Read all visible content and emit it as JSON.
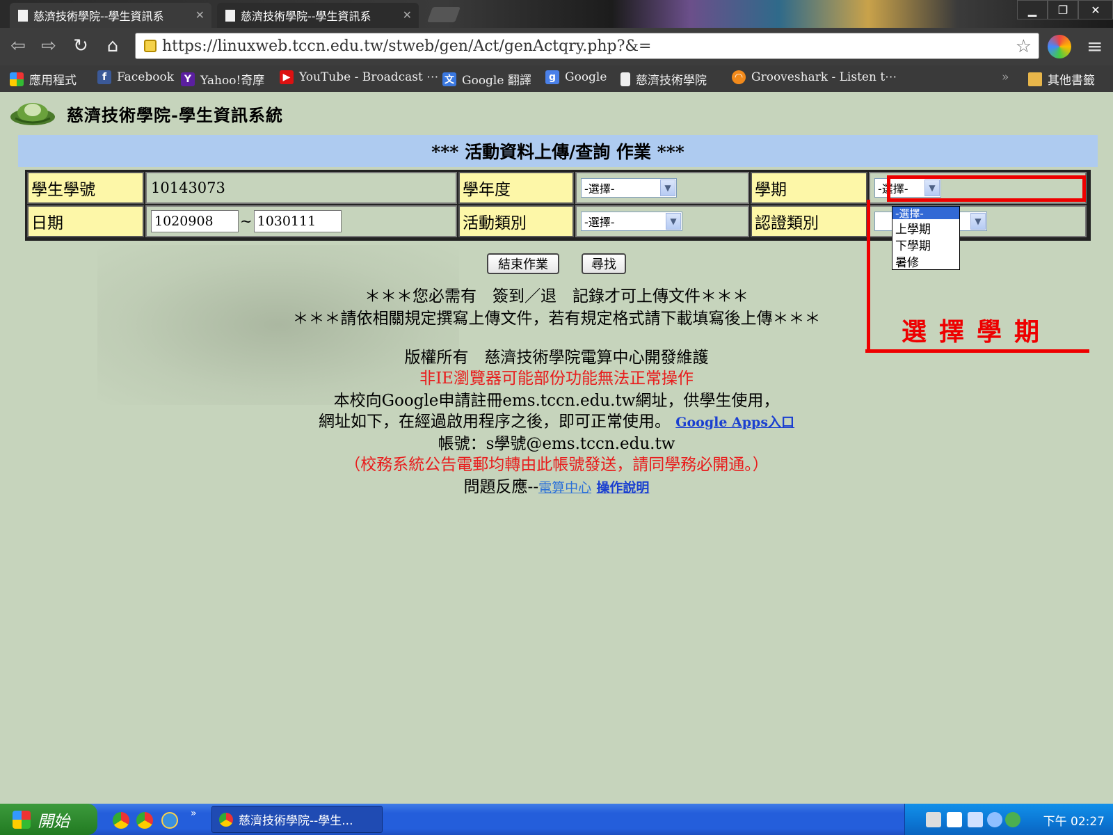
{
  "browser": {
    "tabs": [
      {
        "title": "慈濟技術學院--學生資訊系"
      },
      {
        "title": "慈濟技術學院--學生資訊系"
      }
    ],
    "url": "https://linuxweb.tccn.edu.tw/stweb/gen/Act/genActqry.php?&=",
    "bookmarks": [
      {
        "label": "應用程式",
        "icon": "apps-icon"
      },
      {
        "label": "Facebook",
        "icon": "facebook-icon"
      },
      {
        "label": "Yahoo!奇摩",
        "icon": "yahoo-icon"
      },
      {
        "label": "YouTube - Broadcast ⋯",
        "icon": "youtube-icon"
      },
      {
        "label": "Google 翻譯",
        "icon": "google-translate-icon"
      },
      {
        "label": "Google",
        "icon": "google-icon"
      },
      {
        "label": "慈濟技術學院",
        "icon": "page-icon"
      },
      {
        "label": "Grooveshark - Listen t⋯",
        "icon": "grooveshark-icon"
      }
    ],
    "bookmarks_overflow": "»",
    "other_bookmarks": "其他書籤"
  },
  "page": {
    "system_name": "慈濟技術學院-學生資訊系統",
    "title": "*** 活動資料上傳/查詢 作業 ***",
    "form": {
      "student_id_label": "學生學號",
      "student_id_value": "10143073",
      "year_label": "學年度",
      "year_selected": "-選擇-",
      "semester_label": "學期",
      "semester_selected": "-選擇-",
      "date_label": "日期",
      "date_from": "1020908",
      "date_sep": "~",
      "date_to": "1030111",
      "activity_type_label": "活動類別",
      "activity_type_selected": "-選擇-",
      "cert_type_label": "認證類別",
      "semester_options": [
        "-選擇-",
        "上學期",
        "下學期",
        "暑修"
      ]
    },
    "buttons": {
      "end": "結束作業",
      "search": "尋找"
    },
    "notices": [
      "＊＊＊您必需有　簽到／退　記錄才可上傳文件＊＊＊",
      "＊＊＊請依相關規定撰寫上傳文件，若有規定格式請下載填寫後上傳＊＊＊"
    ],
    "footer": {
      "copyright": "版權所有　慈濟技術學院電算中心開發維護",
      "browser_warning": "非IE瀏覽器可能部份功能無法正常操作",
      "google_line1": "本校向Google申請註冊ems.tccn.edu.tw網址，供學生使用，",
      "google_line2": "網址如下，在經過啟用程序之後，即可正常使用。",
      "google_apps_link": "Google Apps入口",
      "account_line": "帳號：s學號@ems.tccn.edu.tw",
      "mail_notice": "（校務系統公告電郵均轉由此帳號發送，請同學務必開通。）",
      "feedback_label": "問題反應--",
      "computer_center_link": "電算中心",
      "manual_link": "操作說明"
    },
    "annotation": "選擇學期"
  },
  "taskbar": {
    "start_label": "開始",
    "task_item": "慈濟技術學院--學生...",
    "clock": "下午 02:27",
    "quicklaunch_more": "»"
  },
  "colors": {
    "page_bg": "#c6d4bc",
    "title_bar": "#aecbf0",
    "label_cell": "#fdf7a8",
    "annotation_red": "#ee0000",
    "warning_red": "#e81c1c",
    "link_blue": "#1a3fd0"
  }
}
